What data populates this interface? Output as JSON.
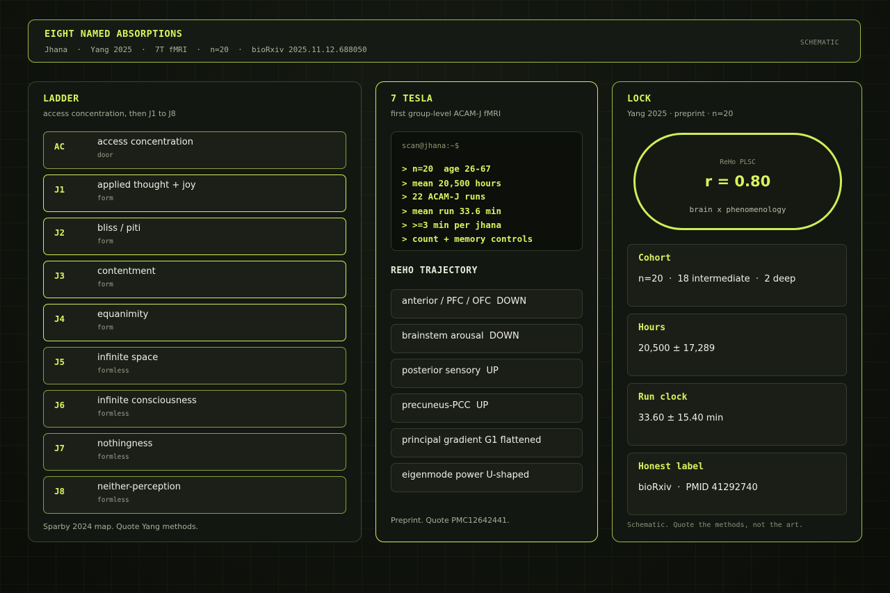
{
  "header": {
    "title": "EIGHT NAMED ABSORPTIONS",
    "subtitle": "Jhana  ·  Yang 2025  ·  7T fMRI  ·  n=20  ·  bioRxiv 2025.11.12.688050",
    "tag": "SCHEMATIC"
  },
  "ladder": {
    "title": "LADDER",
    "subtitle": "access concentration, then J1 to J8",
    "rungs": [
      {
        "code": "AC",
        "name": "access concentration",
        "type": "door"
      },
      {
        "code": "J1",
        "name": "applied thought + joy",
        "type": "form"
      },
      {
        "code": "J2",
        "name": "bliss / piti",
        "type": "form"
      },
      {
        "code": "J3",
        "name": "contentment",
        "type": "form"
      },
      {
        "code": "J4",
        "name": "equanimity",
        "type": "form"
      },
      {
        "code": "J5",
        "name": "infinite space",
        "type": "formless"
      },
      {
        "code": "J6",
        "name": "infinite consciousness",
        "type": "formless"
      },
      {
        "code": "J7",
        "name": "nothingness",
        "type": "formless"
      },
      {
        "code": "J8",
        "name": "neither-perception",
        "type": "formless"
      }
    ],
    "footer": "Sparby 2024 map. Quote Yang methods."
  },
  "tesla": {
    "title": "7 TESLA",
    "subtitle": "first group-level ACAM-J fMRI",
    "prompt": "scan@jhana:~$",
    "lines": [
      "> n=20  age 26-67",
      "> mean 20,500 hours",
      "> 22 ACAM-J runs",
      "> mean run 33.6 min",
      "> >=3 min per jhana",
      "> count + memory controls"
    ],
    "trajectory_title": "REHO TRAJECTORY",
    "trajectory": [
      "anterior / PFC / OFC  DOWN",
      "brainstem arousal  DOWN",
      "posterior sensory  UP",
      "precuneus-PCC  UP",
      "principal gradient G1 flattened",
      "eigenmode power U-shaped"
    ],
    "footer": "Preprint. Quote PMC12642441."
  },
  "lock": {
    "title": "LOCK",
    "subtitle": "Yang 2025  ·  preprint  ·  n=20",
    "pill": {
      "label": "ReHo PLSC",
      "value": "r = 0.80",
      "caption": "brain x phenomenology"
    },
    "stats": [
      {
        "key": "Cohort",
        "value": "n=20  ·  18 intermediate  ·  2 deep"
      },
      {
        "key": "Hours",
        "value": "20,500 ± 17,289"
      },
      {
        "key": "Run clock",
        "value": "33.60 ± 15.40 min"
      },
      {
        "key": "Honest label",
        "value": "bioRxiv  ·  PMID 41292740"
      }
    ],
    "footer": "Schematic. Quote the methods, not the art."
  },
  "colors": {
    "accent": "#d9f25e",
    "border": "#a3b545",
    "background": "#0e110c"
  }
}
